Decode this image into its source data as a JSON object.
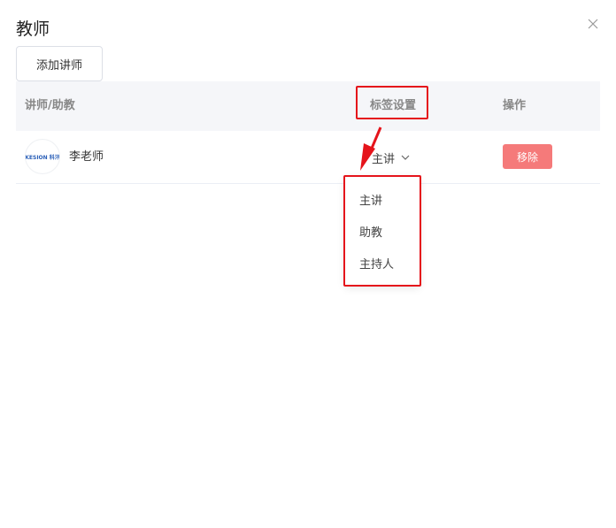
{
  "dialog": {
    "title": "教师",
    "close_icon": "close-icon"
  },
  "toolbar": {
    "add_label": "添加讲师"
  },
  "table": {
    "headers": {
      "name": "讲师/助教",
      "tag": "标签设置",
      "operation": "操作"
    },
    "rows": [
      {
        "avatar_text": "KESION 科汛",
        "name": "李老师",
        "tag": "主讲",
        "action": "移除"
      }
    ]
  },
  "dropdown": {
    "options": [
      "主讲",
      "助教",
      "主持人"
    ]
  },
  "colors": {
    "danger": "#f56c6c",
    "annotation": "#e5141b",
    "header_bg": "#f5f6f9"
  }
}
